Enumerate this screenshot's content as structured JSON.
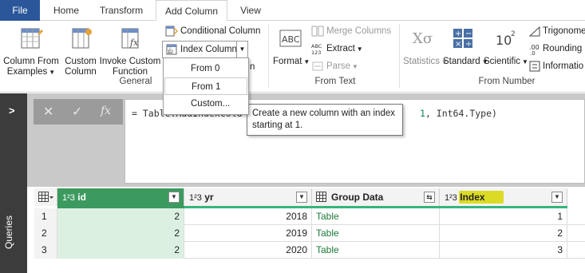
{
  "tabs": [
    "File",
    "Home",
    "Transform",
    "Add Column",
    "View"
  ],
  "ribbon": {
    "general": {
      "column_from_examples": [
        "Column From",
        "Examples"
      ],
      "custom_column": [
        "Custom",
        "Column"
      ],
      "invoke_custom_function": [
        "Invoke Custom",
        "Function"
      ],
      "conditional_column": "Conditional Column",
      "index_column": "Index Column",
      "duplicate_column_partial": "n",
      "group_label": "General"
    },
    "from_text": {
      "format": "Format",
      "merge_columns": "Merge Columns",
      "extract": "Extract",
      "parse": "Parse",
      "group_label": "From Text"
    },
    "from_number": {
      "statistics": "Statistics",
      "standard": "Standard",
      "scientific": "Scientific",
      "trigonometry": "Trigonome",
      "rounding": "Rounding",
      "information": "Informatio",
      "group_label": "From Number"
    }
  },
  "index_menu": {
    "items": [
      "From 0",
      "From 1",
      "Custom..."
    ],
    "highlighted": "From 1"
  },
  "tooltip": "Create a new column with an index starting at 1.",
  "queries_pane": {
    "label": "Queries"
  },
  "formula_bar": {
    "fx": "fx",
    "text_start": "= Table.AddIndexColu",
    "text_end_num": "1",
    "text_end": ", Int64.Type)"
  },
  "grid": {
    "columns": [
      {
        "name": "id",
        "type": "1²3"
      },
      {
        "name": "yr",
        "type": "1²3"
      },
      {
        "name": "Group Data",
        "type": "table"
      },
      {
        "name": "Index",
        "type": "1²3"
      }
    ],
    "rows": [
      {
        "n": "1",
        "id": "2",
        "yr": "2018",
        "group": "Table",
        "index": "1"
      },
      {
        "n": "2",
        "id": "2",
        "yr": "2019",
        "group": "Table",
        "index": "2"
      },
      {
        "n": "3",
        "id": "2",
        "yr": "2020",
        "group": "Table",
        "index": "3"
      }
    ]
  },
  "colors": {
    "file_tab": "#2b579a",
    "selected_header": "#3c9a5f",
    "selected_cells": "#dcf0e2",
    "highlight_yellow": "#ffff00",
    "table_link": "#1f7a3a"
  }
}
